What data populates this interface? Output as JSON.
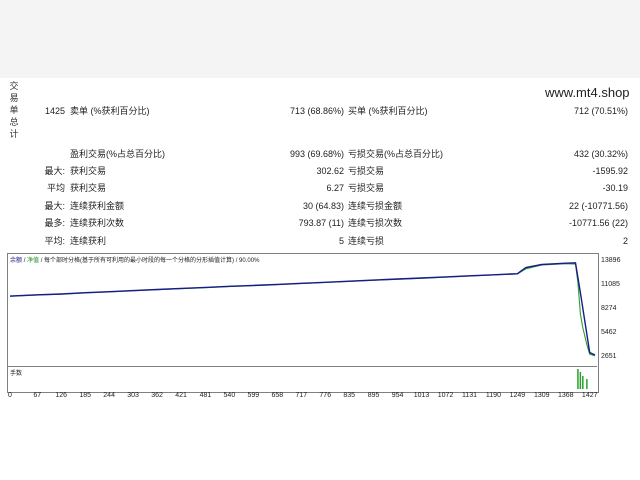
{
  "watermark": "www.mt4.shop",
  "side_label": [
    "交",
    "易",
    "单",
    "总",
    "计"
  ],
  "stats": [
    {
      "c1": "1425",
      "c2": "卖单 (%获利百分比)",
      "c3": "713 (68.86%)",
      "c4": "买单 (%获利百分比)",
      "c5": "712 (70.51%)"
    },
    {
      "c1": "",
      "c2": "盈利交易(%占总百分比)",
      "c3": "993 (69.68%)",
      "c4": "亏损交易(%占总百分比)",
      "c5": "432 (30.32%)"
    },
    {
      "c1": "最大:",
      "c2": "获利交易",
      "c3": "302.62",
      "c4": "亏损交易",
      "c5": "-1595.92"
    },
    {
      "c1": "平均",
      "c2": "获利交易",
      "c3": "6.27",
      "c4": "亏损交易",
      "c5": "-30.19"
    },
    {
      "c1": "最大:",
      "c2": "连续获利金额",
      "c3": "30 (64.83)",
      "c4": "连续亏损金额",
      "c5": "22 (-10771.56)"
    },
    {
      "c1": "最多:",
      "c2": "连续获利次数",
      "c3": "793.87 (11)",
      "c4": "连续亏损次数",
      "c5": "-10771.56 (22)"
    },
    {
      "c1": "平均:",
      "c2": "连续获利",
      "c3": "5",
      "c4": "连续亏损",
      "c5": "2"
    }
  ],
  "chart_title": {
    "balance": "余额",
    "sep": "/",
    "equity": "净值",
    "text": "/ 每个部时分格(基于所有可利用的最小时段的每一个分格的分形插值计算) / 90.00%"
  },
  "volume_label": "手数",
  "chart_data": {
    "type": "line",
    "x_ticks": [
      "0",
      "67",
      "126",
      "185",
      "244",
      "303",
      "362",
      "421",
      "481",
      "540",
      "599",
      "658",
      "717",
      "776",
      "835",
      "895",
      "954",
      "1013",
      "1072",
      "1131",
      "1190",
      "1249",
      "1309",
      "1368",
      "1427"
    ],
    "y_ticks": [
      "13896",
      "11085",
      "8274",
      "5462",
      "2651"
    ],
    "ylim": [
      2651,
      13896
    ],
    "xlim": [
      0,
      1440
    ],
    "series": [
      {
        "name": "余额",
        "color": "#1a1a8c",
        "x": [
          0,
          67,
          126,
          185,
          244,
          303,
          362,
          421,
          481,
          540,
          599,
          658,
          717,
          776,
          835,
          895,
          954,
          1013,
          1072,
          1131,
          1190,
          1249,
          1270,
          1309,
          1368,
          1392,
          1404,
          1427,
          1440
        ],
        "y": [
          9900,
          10050,
          10150,
          10300,
          10420,
          10550,
          10680,
          10800,
          10920,
          11050,
          11150,
          11270,
          11400,
          11520,
          11650,
          11780,
          11900,
          12020,
          12150,
          12280,
          12400,
          12520,
          13250,
          13600,
          13750,
          13800,
          10300,
          3300,
          3000
        ]
      },
      {
        "name": "净值",
        "color": "#2aa02a",
        "x": [
          0,
          67,
          126,
          185,
          244,
          303,
          362,
          421,
          481,
          540,
          599,
          658,
          717,
          776,
          835,
          895,
          954,
          1013,
          1072,
          1131,
          1190,
          1249,
          1270,
          1309,
          1368,
          1392,
          1398,
          1404,
          1410,
          1420,
          1427,
          1440
        ],
        "y": [
          9880,
          10020,
          10120,
          10270,
          10380,
          10520,
          10650,
          10770,
          10890,
          11020,
          11120,
          11240,
          11370,
          11490,
          11620,
          11750,
          11870,
          11990,
          12120,
          12250,
          12370,
          12490,
          13100,
          13550,
          13700,
          13650,
          11500,
          7800,
          6200,
          4200,
          3100,
          2900
        ]
      }
    ]
  }
}
